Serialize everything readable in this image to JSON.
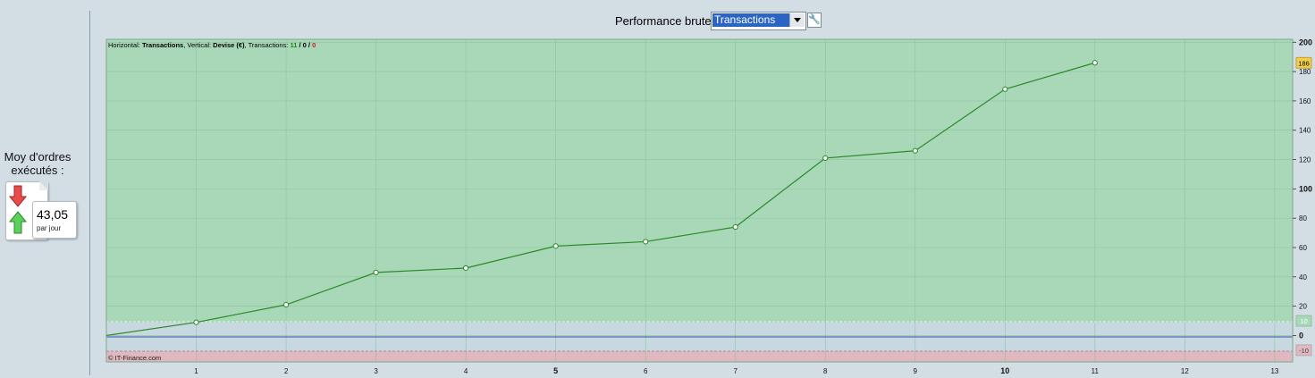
{
  "left_panel": {
    "title_line1": "Moy d'ordres",
    "title_line2": "exécutés :",
    "value": "43,05",
    "unit": "par jour"
  },
  "header": {
    "label": "Performance brute",
    "select_value": "Transactions"
  },
  "chart_data": {
    "type": "line",
    "info": {
      "horizontal_label": "Horizontal: ",
      "horizontal_value": "Transactions",
      "vertical_label": ", Vertical: ",
      "vertical_value": "Devise (€)",
      "transactions_label": ", Transactions: ",
      "count_total": "11",
      "sep1": " / ",
      "count_mid": "0",
      "sep2": " / ",
      "count_loss": "0"
    },
    "watermark": "© IT-Finance.com",
    "x": [
      0,
      1,
      2,
      3,
      4,
      5,
      6,
      7,
      8,
      9,
      10,
      11
    ],
    "values": [
      0,
      9,
      21,
      43,
      46,
      61,
      64,
      74,
      121,
      126,
      168,
      186
    ],
    "x_ticks": [
      1,
      2,
      3,
      4,
      5,
      6,
      7,
      8,
      9,
      10,
      11,
      12,
      13
    ],
    "x_bold_ticks": [
      5,
      10
    ],
    "xlim": [
      0,
      13.2
    ],
    "y_ticks": [
      0,
      20,
      40,
      60,
      80,
      100,
      120,
      140,
      160,
      180,
      200
    ],
    "y_bold_ticks": [
      0,
      100,
      200
    ],
    "ylim": [
      -18,
      202
    ],
    "upper_threshold": 10,
    "lower_threshold": -10,
    "last_value_label": "186",
    "upper_threshold_label": "10",
    "lower_threshold_label": "-10",
    "grid": true,
    "colors": {
      "profit_zone": "#a8d8b8",
      "neutral_zone": "#c8d8e0",
      "loss_zone": "#e0b8c0",
      "line": "#2a8a2a",
      "zero_line": "#3355aa",
      "count_total": "#1a8a1a",
      "count_mid": "#000000",
      "count_loss": "#cc2222",
      "last_value_badge": "#f2cf4a"
    }
  }
}
